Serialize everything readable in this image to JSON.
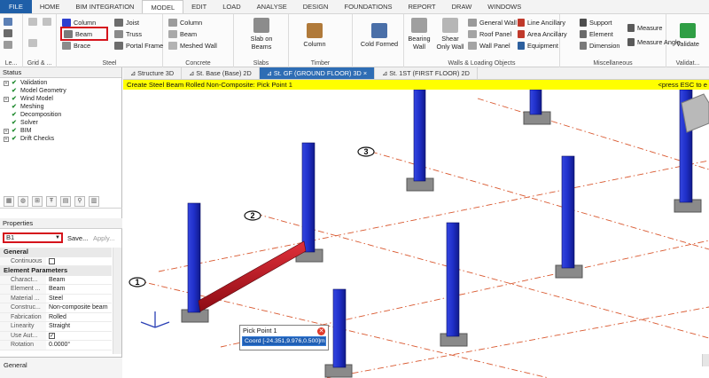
{
  "ribbon_tabs": [
    "FILE",
    "HOME",
    "BIM INTEGRATION",
    "MODEL",
    "EDIT",
    "LOAD",
    "ANALYSE",
    "DESIGN",
    "FOUNDATIONS",
    "REPORT",
    "DRAW",
    "WINDOWS"
  ],
  "active_tab": "MODEL",
  "groups": {
    "left": {
      "label": "Le..."
    },
    "grid": {
      "label": "Grid & ..."
    },
    "steel": {
      "label": "Steel",
      "column": "Column",
      "joist": "Joist",
      "beam": "Beam",
      "truss": "Truss",
      "brace": "Brace",
      "portal_frame": "Portal Frame"
    },
    "concrete": {
      "label": "Concrete",
      "column": "Column",
      "beam": "Beam",
      "meshed_wall": "Meshed Wall"
    },
    "slabs": {
      "label": "Slabs",
      "slab_on_beams": "Slab on Beams"
    },
    "timber": {
      "label": "Timber",
      "column": "Column"
    },
    "cold": {
      "label": "",
      "cold_formed": "Cold Formed"
    },
    "walls": {
      "label": "Walls & Loading Objects",
      "bearing_wall": "Bearing Wall",
      "shear_only_wall": "Shear Only Wall",
      "general_wall": "General Wall",
      "roof_panel": "Roof Panel",
      "wall_panel": "Wall Panel",
      "line_ancillary": "Line Ancillary",
      "area_ancillary": "Area Ancillary",
      "equipment": "Equipment"
    },
    "misc": {
      "label": "Miscellaneous",
      "support": "Support",
      "element": "Element",
      "dimension": "Dimension",
      "measure": "Measure",
      "measure_angle": "Measure Angle"
    },
    "validate": {
      "label": "Validat...",
      "validate": "Validate"
    }
  },
  "status_panel": {
    "title": "Status",
    "items": [
      {
        "label": "Validation",
        "check": true,
        "expand": true
      },
      {
        "label": "Model Geometry",
        "check": true,
        "expand": false
      },
      {
        "label": "Wind Model",
        "check": true,
        "expand": true
      },
      {
        "label": "Meshing",
        "check": true,
        "expand": false
      },
      {
        "label": "Decomposition",
        "check": true,
        "expand": false
      },
      {
        "label": "Solver",
        "check": true,
        "expand": false
      },
      {
        "label": "BIM",
        "check": true,
        "expand": true
      },
      {
        "label": "Drift Checks",
        "check": true,
        "expand": true
      }
    ]
  },
  "properties": {
    "title": "Properties",
    "selected": "B1",
    "save_label": "Save...",
    "apply_label": "Apply...",
    "sections": [
      {
        "title": "General",
        "rows": [
          {
            "key": "Continuous",
            "value": "",
            "checkbox": true,
            "checked": false
          }
        ]
      },
      {
        "title": "Element Parameters",
        "rows": [
          {
            "key": "Charact...",
            "value": "Beam"
          },
          {
            "key": "Element ...",
            "value": "Beam"
          },
          {
            "key": "Material ...",
            "value": "Steel"
          },
          {
            "key": "Construc...",
            "value": "Non-composite beam"
          },
          {
            "key": "Fabrication",
            "value": "Rolled"
          },
          {
            "key": "Linearity",
            "value": "Straight"
          },
          {
            "key": "Use Aut...",
            "value": "",
            "checkbox": true,
            "checked": true
          },
          {
            "key": "Rotation",
            "value": "0.0000°"
          }
        ]
      }
    ],
    "footer": "General"
  },
  "view_tabs": [
    "Structure 3D",
    "St. Base (Base) 2D",
    "St. GF (GROUND FLOOR) 3D",
    "St. 1ST (FIRST FLOOR) 2D"
  ],
  "active_view": "St. GF (GROUND FLOOR) 3D",
  "prompt": {
    "text": "Create Steel Beam Rolled Non-Composite: Pick Point 1",
    "esc": "<press ESC to e"
  },
  "grid_bubbles": [
    "1",
    "2",
    "3"
  ],
  "pick_point": {
    "title": "Pick Point 1",
    "value": "Coord [-24.351,9.976,0.500]m"
  },
  "colors": {
    "column": "#1f2fc9",
    "beam": "#b5121b",
    "gridline": "#d9582f",
    "prompt": "#ffff00",
    "highlight": "#d5141c"
  }
}
